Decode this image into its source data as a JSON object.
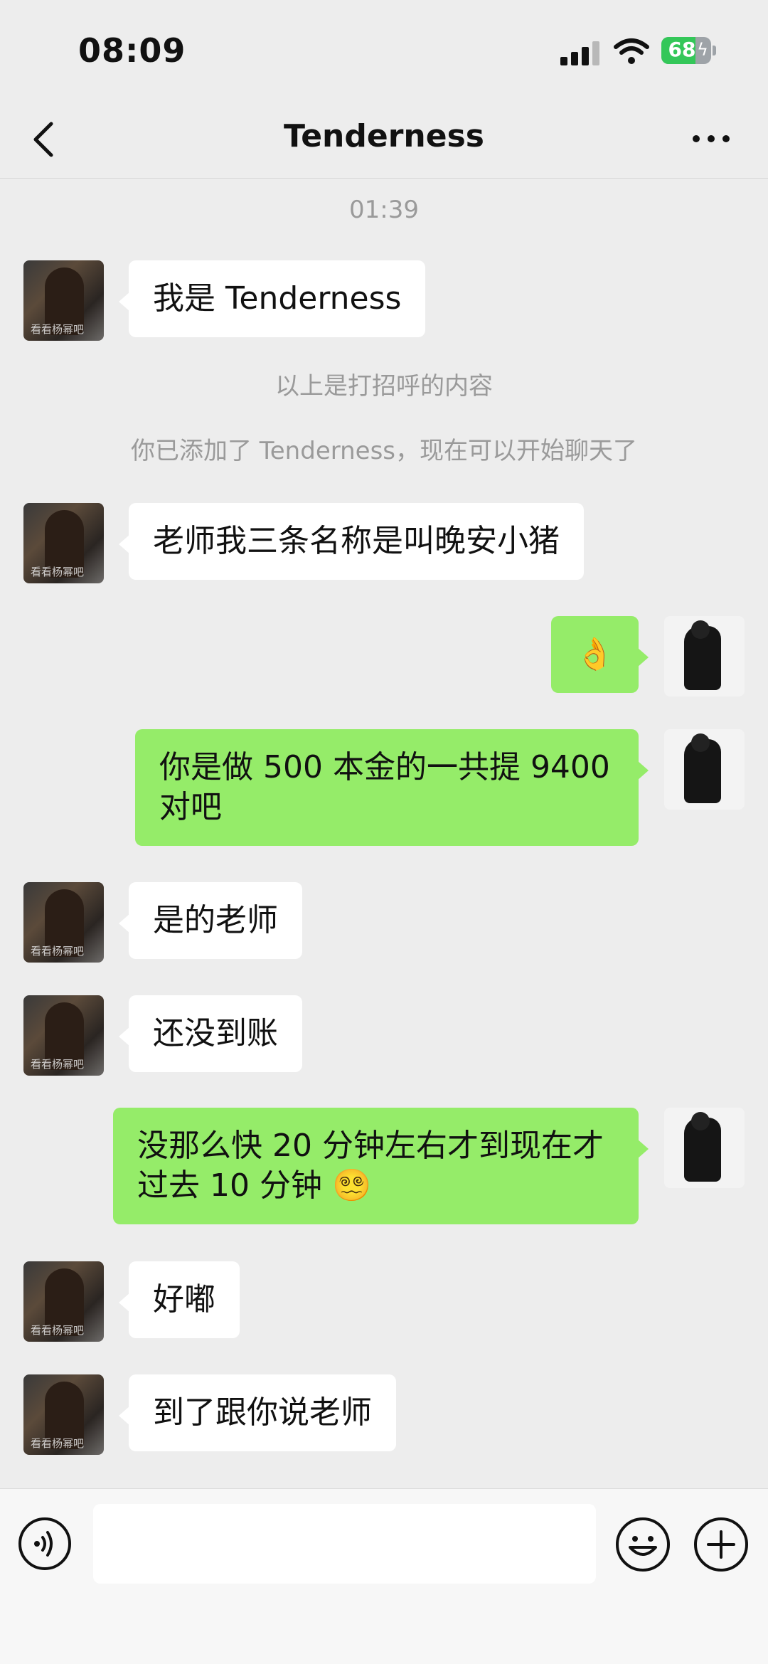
{
  "status": {
    "time": "08:09",
    "battery": "68",
    "battery_level": 0.68
  },
  "header": {
    "title": "Tenderness"
  },
  "chat": {
    "timestamp": "01:39",
    "system_1": "以上是打招呼的内容",
    "system_2": "你已添加了 Tenderness，现在可以开始聊天了",
    "messages": [
      {
        "from": "other",
        "text": "我是 Tenderness"
      },
      {
        "from": "other",
        "text": "老师我三条名称是叫晚安小猪"
      },
      {
        "from": "me",
        "text": "👌"
      },
      {
        "from": "me",
        "text": "你是做 500 本金的一共提 9400 对吧"
      },
      {
        "from": "other",
        "text": "是的老师"
      },
      {
        "from": "other",
        "text": "还没到账"
      },
      {
        "from": "me",
        "text": "没那么快 20 分钟左右才到现在才过去 10 分钟 😵‍💫"
      },
      {
        "from": "other",
        "text": "好嘟"
      },
      {
        "from": "other",
        "text": "到了跟你说老师"
      }
    ],
    "avatar_watermark": "看看杨幂吧"
  },
  "input": {
    "value": "",
    "placeholder": ""
  },
  "colors": {
    "background": "#ededed",
    "sent_bubble": "#95ec69",
    "received_bubble": "#ffffff",
    "system_text": "#9a9a9a"
  },
  "icons": [
    "back-icon",
    "more-icon",
    "voice-icon",
    "emoji-icon",
    "plus-icon",
    "signal-icon",
    "wifi-icon",
    "battery-icon"
  ]
}
